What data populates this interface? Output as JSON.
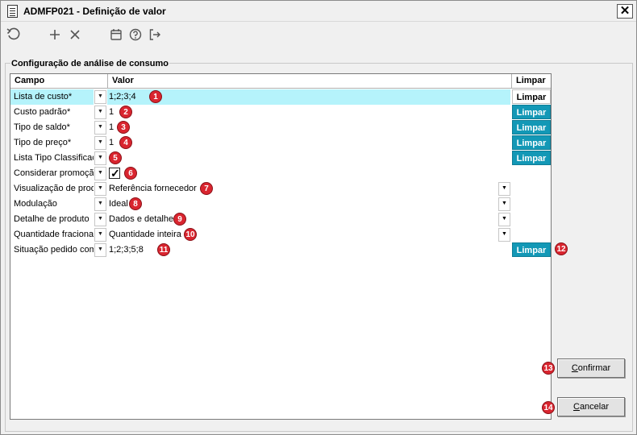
{
  "window": {
    "title": "ADMFP021 - Definição de valor"
  },
  "toolbar": {
    "icons": [
      "refresh-icon",
      "add-icon",
      "delete-icon",
      "calendar-icon",
      "help-icon",
      "exit-icon"
    ]
  },
  "group": {
    "label": "Configuração de análise de consumo"
  },
  "grid": {
    "headers": {
      "campo": "Campo",
      "valor": "Valor",
      "limpar": "Limpar"
    },
    "rows": [
      {
        "campo": "Lista de custo*",
        "valor": "1;2;3;4",
        "limpar": "Limpar",
        "badge": "1"
      },
      {
        "campo": "Custo padrão*",
        "valor": "1",
        "limpar": "Limpar",
        "badge": "2"
      },
      {
        "campo": "Tipo de saldo*",
        "valor": "1",
        "limpar": "Limpar",
        "badge": "3"
      },
      {
        "campo": "Tipo de preço*",
        "valor": "1",
        "limpar": "Limpar",
        "badge": "4"
      },
      {
        "campo": "Lista Tipo Classificação",
        "valor": "",
        "limpar": "Limpar",
        "badge": "5"
      },
      {
        "campo": "Considerar promoção",
        "valor": "",
        "badge": "6"
      },
      {
        "campo": "Visualização de produto",
        "valor": "Referência fornecedor",
        "badge": "7"
      },
      {
        "campo": "Modulação",
        "valor": "Ideal",
        "badge": "8"
      },
      {
        "campo": "Detalhe de produto",
        "valor": "Dados e detalhe",
        "badge": "9"
      },
      {
        "campo": "Quantidade fracionada",
        "valor": "Quantidade inteira",
        "badge": "10"
      },
      {
        "campo": "Situação pedido compra",
        "valor": "1;2;3;5;8",
        "limpar": "Limpar",
        "badge": "11"
      }
    ],
    "side_badge": "12"
  },
  "buttons": {
    "confirm_hot": "C",
    "confirm_rest": "onfirmar",
    "confirm_badge": "13",
    "cancel_hot": "C",
    "cancel_rest": "ancelar",
    "cancel_badge": "14"
  },
  "colors": {
    "selected_row": "#b5f3fb",
    "limpar_button": "#1398b6",
    "badge": "#d9252f"
  }
}
